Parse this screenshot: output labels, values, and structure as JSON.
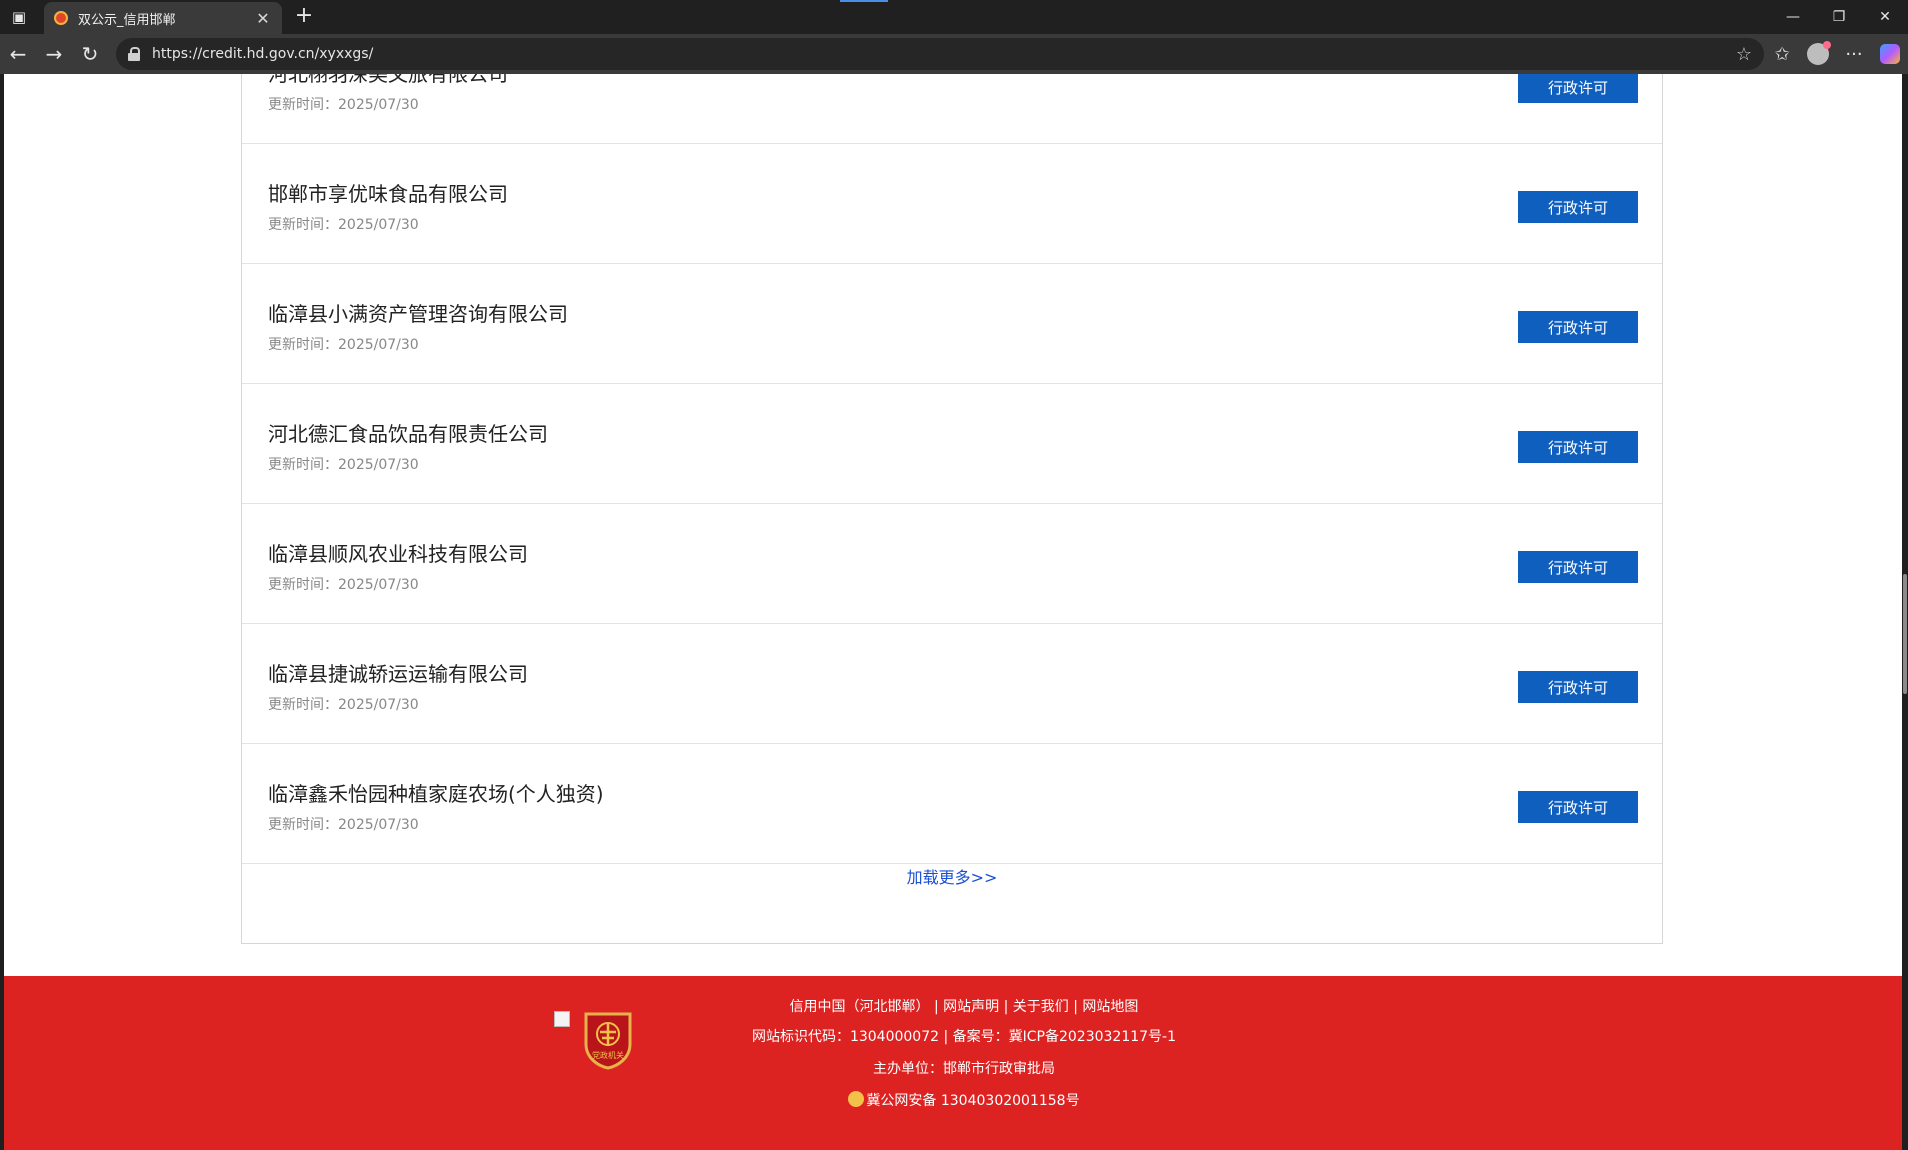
{
  "browser": {
    "tab_title": "双公示_信用邯郸",
    "url": "https://credit.hd.gov.cn/xyxxgs/"
  },
  "list": {
    "items": [
      {
        "title": "河北栩羽深美文旅有限公司",
        "date": "更新时间：2025/07/30",
        "button": "行政许可"
      },
      {
        "title": "邯郸市享优味食品有限公司",
        "date": "更新时间：2025/07/30",
        "button": "行政许可"
      },
      {
        "title": "临漳县小满资产管理咨询有限公司",
        "date": "更新时间：2025/07/30",
        "button": "行政许可"
      },
      {
        "title": "河北德汇食品饮品有限责任公司",
        "date": "更新时间：2025/07/30",
        "button": "行政许可"
      },
      {
        "title": "临漳县顺风农业科技有限公司",
        "date": "更新时间：2025/07/30",
        "button": "行政许可"
      },
      {
        "title": "临漳县捷诚轿运运输有限公司",
        "date": "更新时间：2025/07/30",
        "button": "行政许可"
      },
      {
        "title": "临漳鑫禾怡园种植家庭农场(个人独资)",
        "date": "更新时间：2025/07/30",
        "button": "行政许可"
      }
    ],
    "load_more": "加载更多>>"
  },
  "footer": {
    "links_line": "信用中国（河北邯郸） | 网站声明 | 关于我们 | 网站地图",
    "id_line": "网站标识代码：1304000072 | 备案号：冀ICP备2023032117号-1",
    "host_line": "主办单位：邯郸市行政审批局",
    "police_line": "冀公网安备 13040302001158号",
    "badge_text": "党政机关"
  },
  "colors": {
    "button_blue": "#0f5fbf",
    "footer_red": "#dd2222",
    "link_blue": "#1a4fd6"
  }
}
